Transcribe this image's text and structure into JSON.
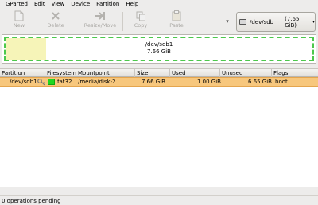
{
  "menu": [
    "GParted",
    "Edit",
    "View",
    "Device",
    "Partition",
    "Help"
  ],
  "toolbar": {
    "new": "New",
    "delete": "Delete",
    "resize_move": "Resize/Move",
    "copy": "Copy",
    "paste": "Paste"
  },
  "device": {
    "name": "/dev/sdb",
    "size": "(7.65 GiB)"
  },
  "map": {
    "partition": "/dev/sdb1",
    "size": "7.66 GiB"
  },
  "table": {
    "headers": [
      "Partition",
      "Filesystem",
      "Mountpoint",
      "Size",
      "Used",
      "Unused",
      "Flags"
    ],
    "rows": [
      {
        "partition": "/dev/sdb1",
        "filesystem": "fat32",
        "mountpoint": "/media/disk-2",
        "size": "7.66 GiB",
        "used": "1.00 GiB",
        "unused": "6.65 GiB",
        "flags": "boot"
      }
    ]
  },
  "status": "0 operations pending",
  "colors": {
    "selection": "#f7c77d",
    "fat32": "#1fd71f",
    "map_border": "#4cc84c",
    "used_space": "#f6f4b8"
  },
  "icons": [
    "new-icon",
    "delete-icon",
    "resize-move-icon",
    "copy-icon",
    "paste-icon",
    "disk-icon",
    "key-icon"
  ]
}
